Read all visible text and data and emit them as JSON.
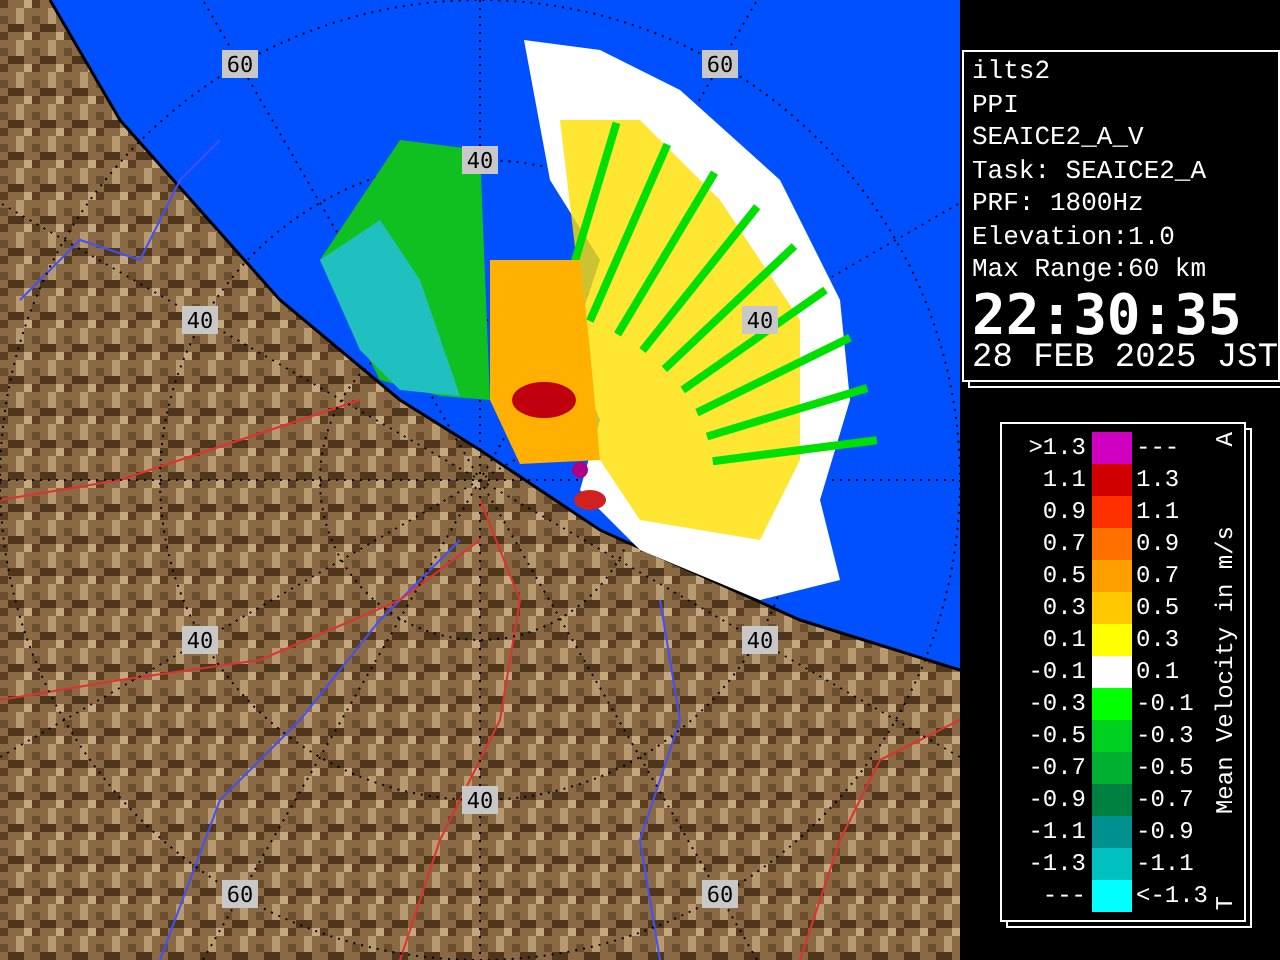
{
  "map": {
    "range_labels": [
      "60",
      "60",
      "40",
      "40",
      "40",
      "40",
      "40",
      "40",
      "60",
      "60"
    ]
  },
  "info": {
    "lines": [
      "ilts2",
      "PPI",
      "SEAICE2_A_V",
      "Task: SEAICE2_A",
      "PRF: 1800Hz",
      "Elevation:1.0",
      "Max Range:60 km"
    ],
    "time": "22:30:35",
    "date": "28 FEB 2025 JST"
  },
  "legend": {
    "title": "Mean Velocity in m/s",
    "top_mark": "A",
    "bottom_mark": "T",
    "rows": [
      {
        "low": ">1.3",
        "high": "---",
        "color": "#d000c0"
      },
      {
        "low": "1.1",
        "high": "1.3",
        "color": "#d00000"
      },
      {
        "low": "0.9",
        "high": "1.1",
        "color": "#ff3000"
      },
      {
        "low": "0.7",
        "high": "0.9",
        "color": "#ff7000"
      },
      {
        "low": "0.5",
        "high": "0.7",
        "color": "#ffa000"
      },
      {
        "low": "0.3",
        "high": "0.5",
        "color": "#ffc800"
      },
      {
        "low": "0.1",
        "high": "0.3",
        "color": "#ffff00"
      },
      {
        "low": "-0.1",
        "high": "0.1",
        "color": "#ffffff"
      },
      {
        "low": "-0.3",
        "high": "-0.1",
        "color": "#00ff00"
      },
      {
        "low": "-0.5",
        "high": "-0.3",
        "color": "#00d020"
      },
      {
        "low": "-0.7",
        "high": "-0.5",
        "color": "#00b030"
      },
      {
        "low": "-0.9",
        "high": "-0.7",
        "color": "#008040"
      },
      {
        "low": "-1.1",
        "high": "-0.9",
        "color": "#009090"
      },
      {
        "low": "-1.3",
        "high": "-1.1",
        "color": "#00c0c0"
      },
      {
        "low": "---",
        "high": "<-1.3",
        "color": "#00ffff"
      }
    ]
  }
}
